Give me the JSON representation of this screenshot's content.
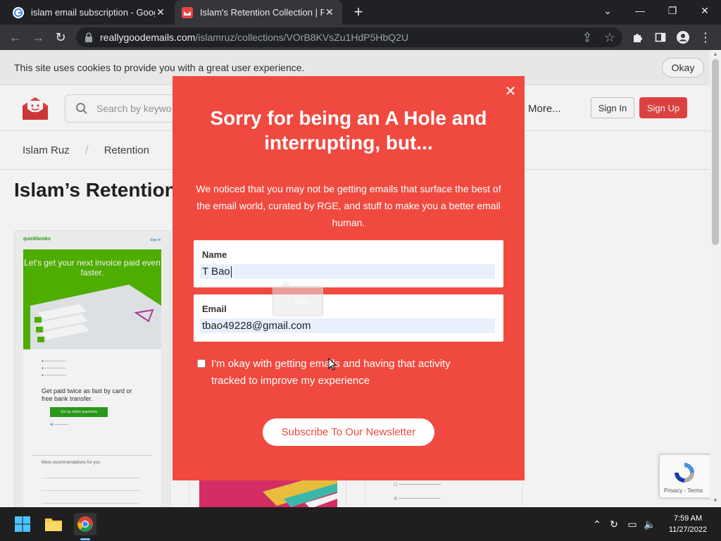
{
  "browser": {
    "tabs": [
      {
        "title": "islam email subscription - Google Search"
      },
      {
        "title": "Islam's Retention Collection | Really Good Emails"
      }
    ],
    "url_domain": "reallygoodemails.com",
    "url_path": "/islamruz/collections/VOrB8KVsZu1HdP5HbQ2U"
  },
  "page": {
    "cookie_text": "This site uses cookies to provide you with a great user experience.",
    "cookie_ok": "Okay",
    "search_placeholder": "Search by keywo",
    "more": "More...",
    "sign_in": "Sign In",
    "sign_up": "Sign Up",
    "breadcrumb": [
      "Islam Ruz",
      "/",
      "Retention"
    ],
    "title": "Islam’s Retention",
    "qb_brand": "quickbooks",
    "qb_help": "Sign in",
    "qb_headline": "Let's get your next invoice paid even faster.",
    "qb_getpaid": "Get paid twice as fast by card or free bank transfer.",
    "qb_button": "Set up online payments",
    "qb_more": "More recommendations for you",
    "recaptcha": "Privacy - Terms"
  },
  "modal": {
    "title": "Sorry for being an A Hole and interrupting, but...",
    "description": "We noticed that you may not be getting emails that surface the best of the email world, curated by RGE, and stuff to make you a better email human.",
    "name_label": "Name",
    "name_value": "T Bao",
    "autofill_suggestion": "T Bao",
    "email_label": "Email",
    "email_value": "tbao49228@gmail.com",
    "consent": "I'm okay with getting emails and having that activity tracked to improve my experience",
    "consent_checked": false,
    "subscribe": "Subscribe To Our Newsletter"
  },
  "taskbar": {
    "time": "7:59 AM",
    "date": "11/27/2022"
  },
  "colors": {
    "modal_bg": "#f04a40",
    "brand_red": "#e84545",
    "qb_green": "#53b700"
  }
}
